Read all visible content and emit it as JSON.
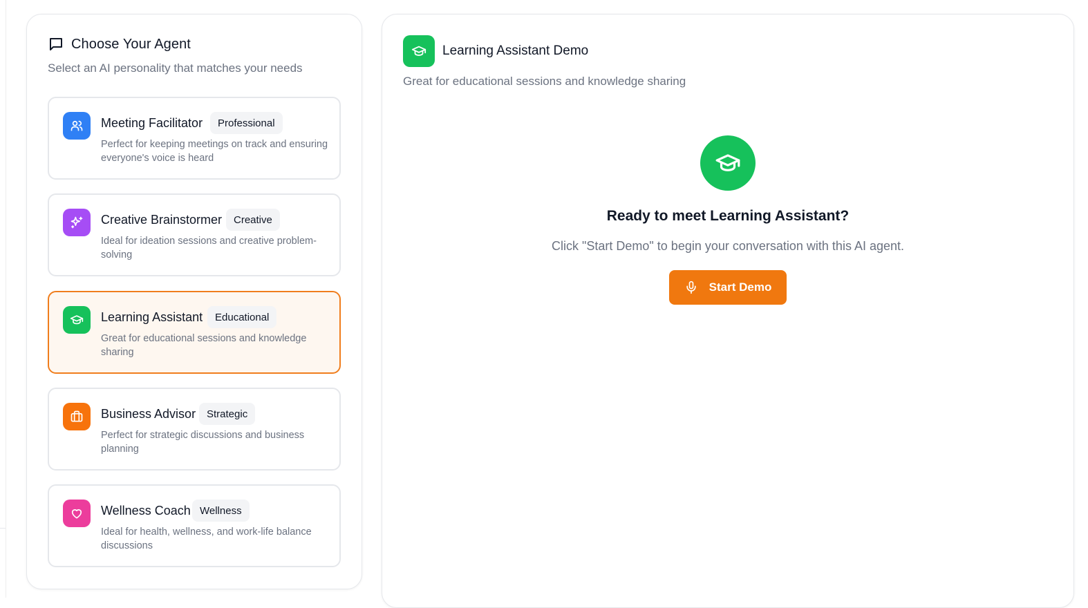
{
  "sidebar": {
    "title": "Choose Your Agent",
    "subtitle": "Select an AI personality that matches your needs",
    "title_icon": "message-square-icon"
  },
  "agents": [
    {
      "name": "Meeting Facilitator",
      "badge": "Professional",
      "description": "Perfect for keeping meetings on track and ensuring everyone's voice is heard",
      "icon": "users-icon",
      "color": "#2f80f5",
      "selected": false
    },
    {
      "name": "Creative Brainstormer",
      "badge": "Creative",
      "description": "Ideal for ideation sessions and creative problem-solving",
      "icon": "sparkles-icon",
      "color": "#a64df5",
      "selected": false
    },
    {
      "name": "Learning Assistant",
      "badge": "Educational",
      "description": "Great for educational sessions and knowledge sharing",
      "icon": "graduation-cap-icon",
      "color": "#16c15b",
      "selected": true
    },
    {
      "name": "Business Advisor",
      "badge": "Strategic",
      "description": "Perfect for strategic discussions and business planning",
      "icon": "briefcase-icon",
      "color": "#f7730c",
      "selected": false
    },
    {
      "name": "Wellness Coach",
      "badge": "Wellness",
      "description": "Ideal for health, wellness, and work-life balance discussions",
      "icon": "heart-icon",
      "color": "#ec3d9c",
      "selected": false
    }
  ],
  "demo": {
    "title": "Learning Assistant Demo",
    "subtitle": "Great for educational sessions and knowledge sharing",
    "icon": "graduation-cap-icon",
    "accent_color": "#16c15b",
    "ready_title": "Ready to meet Learning Assistant?",
    "ready_text": "Click \"Start Demo\" to begin your conversation with this AI agent.",
    "start_button_label": "Start Demo",
    "start_button_icon": "microphone-icon",
    "start_button_color": "#f0780f"
  }
}
